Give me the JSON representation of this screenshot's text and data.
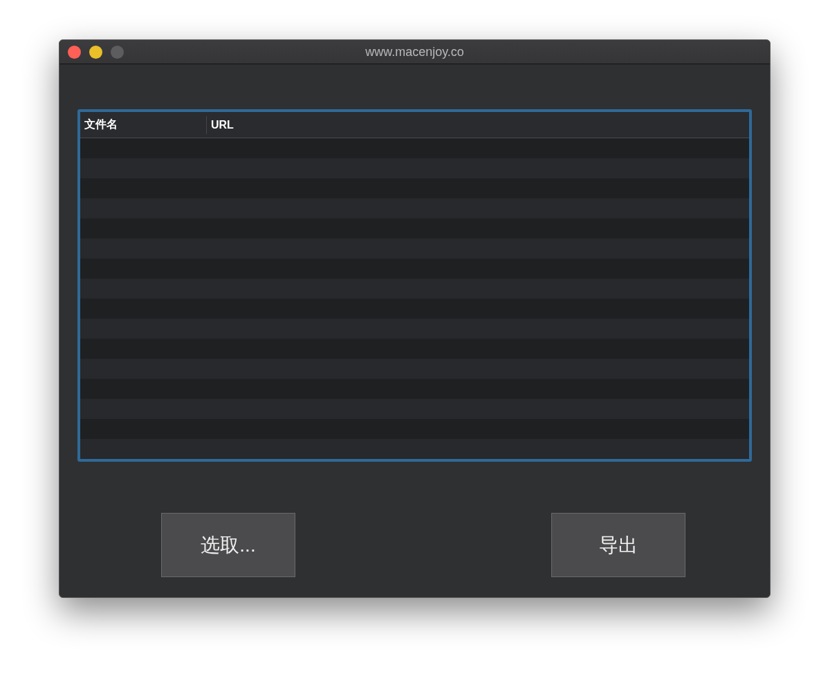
{
  "window": {
    "title": "www.macenjoy.co"
  },
  "table": {
    "columns": [
      "文件名",
      "URL"
    ]
  },
  "buttons": [
    "选取...",
    "导出"
  ]
}
